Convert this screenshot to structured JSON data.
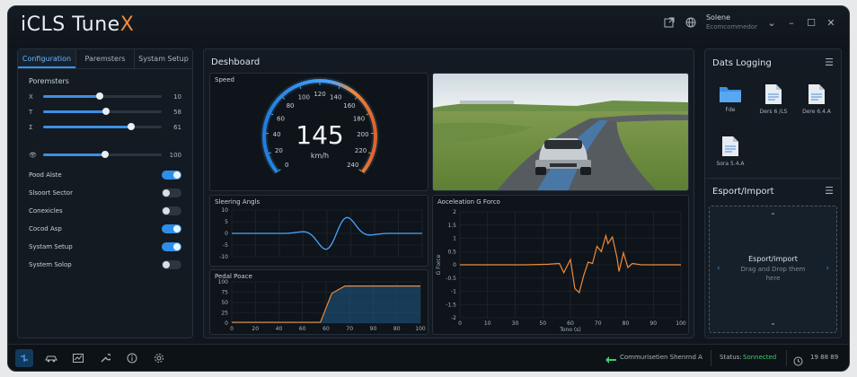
{
  "app": {
    "title_main": "iCLS Tune",
    "title_accent": "X",
    "user_name": "Solene",
    "user_sub": "Ecomcommedor"
  },
  "left_panel": {
    "tabs": [
      "Configuration",
      "Paremsters",
      "Systam Setup"
    ],
    "section_title": "Poremsters",
    "sliders": [
      {
        "icon": "X",
        "value_label": "10",
        "level": 0.48
      },
      {
        "icon": "T",
        "value_label": "58",
        "level": 0.53
      },
      {
        "icon": "Σ",
        "value_label": "61",
        "level": 0.74
      },
      {
        "icon": "👁",
        "value_label": "100",
        "level": 0.52
      }
    ],
    "toggles": [
      {
        "label": "Pood Alste",
        "on": true
      },
      {
        "label": "Slsoort Sector",
        "on": false
      },
      {
        "label": "Conexicles",
        "on": false
      },
      {
        "label": "Cocod Asp",
        "on": true
      },
      {
        "label": "Systam Setup",
        "on": true
      },
      {
        "label": "System Solop",
        "on": false
      }
    ]
  },
  "dashboard": {
    "title": "Deshboard",
    "speed": {
      "label": "Speed",
      "value": "145",
      "unit": "km/h",
      "ticks": [
        "0",
        "20",
        "40",
        "60",
        "80",
        "100",
        "120",
        "140",
        "160",
        "180",
        "200",
        "220",
        "240"
      ]
    },
    "steering": {
      "label": "Sleering Angls",
      "yticks": [
        "10",
        "5",
        "0",
        "-5",
        "-10"
      ]
    },
    "pedal": {
      "label": "Pedal Poace",
      "yticks": [
        "100",
        "75",
        "50",
        "25",
        "0"
      ],
      "xticks": [
        "0",
        "20",
        "40",
        "60",
        "60",
        "70",
        "90",
        "80",
        "100"
      ]
    },
    "accel": {
      "label": "Aoceleation G Forco",
      "ylabel": "G Force",
      "xlabel": "Tono (s)",
      "yticks": [
        "2",
        "1.5",
        "1",
        "0.5",
        "0",
        "-0.5",
        "-1",
        "-1.5",
        "-2"
      ],
      "xticks": [
        "0",
        "10",
        "30",
        "50",
        "60",
        "70",
        "80",
        "90",
        "100"
      ]
    }
  },
  "right_panel": {
    "logging_title": "Dats Logging",
    "files": [
      {
        "name": "Fde",
        "kind": "folder"
      },
      {
        "name": "Ders 6 /LS",
        "kind": "doc"
      },
      {
        "name": "Dere 6.4.A",
        "kind": "doc"
      },
      {
        "name": "Sora 5.4.A",
        "kind": "doc"
      }
    ],
    "export_title": "Esport/Import",
    "drop_title": "Esport/import",
    "drop_hint_1": "Drag and Drop them",
    "drop_hint_2": "here"
  },
  "statusbar": {
    "comm_label": "Commurisetien Shenrnd A",
    "status_label": "Status:",
    "status_value": "Sonnected",
    "time": "19 88 89"
  },
  "colors": {
    "accent_blue": "#3d8fe3",
    "accent_orange": "#f08a3a",
    "status_green": "#3ecb6a"
  }
}
